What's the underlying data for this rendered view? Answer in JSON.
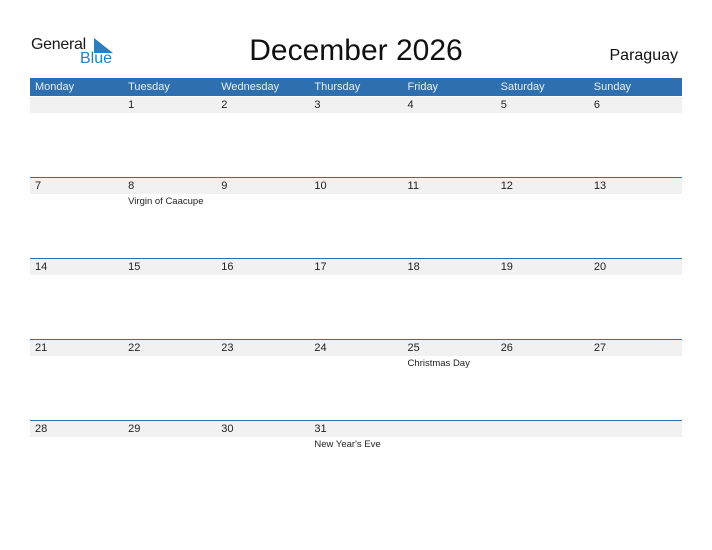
{
  "logo": {
    "line1": "General",
    "line2": "Blue"
  },
  "title": "December 2026",
  "country": "Paraguay",
  "colors": {
    "header_bg": "#2e6fb0",
    "logo_blue": "#2a7fc1",
    "strip_bg": "#f1f1f1"
  },
  "weekdays": [
    "Monday",
    "Tuesday",
    "Wednesday",
    "Thursday",
    "Friday",
    "Saturday",
    "Sunday"
  ],
  "weeks": [
    [
      {
        "day": ""
      },
      {
        "day": "1"
      },
      {
        "day": "2"
      },
      {
        "day": "3"
      },
      {
        "day": "4"
      },
      {
        "day": "5"
      },
      {
        "day": "6"
      }
    ],
    [
      {
        "day": "7"
      },
      {
        "day": "8",
        "event": "Virgin of Caacupe"
      },
      {
        "day": "9"
      },
      {
        "day": "10"
      },
      {
        "day": "11"
      },
      {
        "day": "12"
      },
      {
        "day": "13"
      }
    ],
    [
      {
        "day": "14"
      },
      {
        "day": "15"
      },
      {
        "day": "16"
      },
      {
        "day": "17"
      },
      {
        "day": "18"
      },
      {
        "day": "19"
      },
      {
        "day": "20"
      }
    ],
    [
      {
        "day": "21"
      },
      {
        "day": "22"
      },
      {
        "day": "23"
      },
      {
        "day": "24"
      },
      {
        "day": "25",
        "event": "Christmas Day"
      },
      {
        "day": "26"
      },
      {
        "day": "27"
      }
    ],
    [
      {
        "day": "28"
      },
      {
        "day": "29"
      },
      {
        "day": "30"
      },
      {
        "day": "31",
        "event": "New Year's Eve"
      },
      {
        "day": ""
      },
      {
        "day": ""
      },
      {
        "day": ""
      }
    ]
  ]
}
